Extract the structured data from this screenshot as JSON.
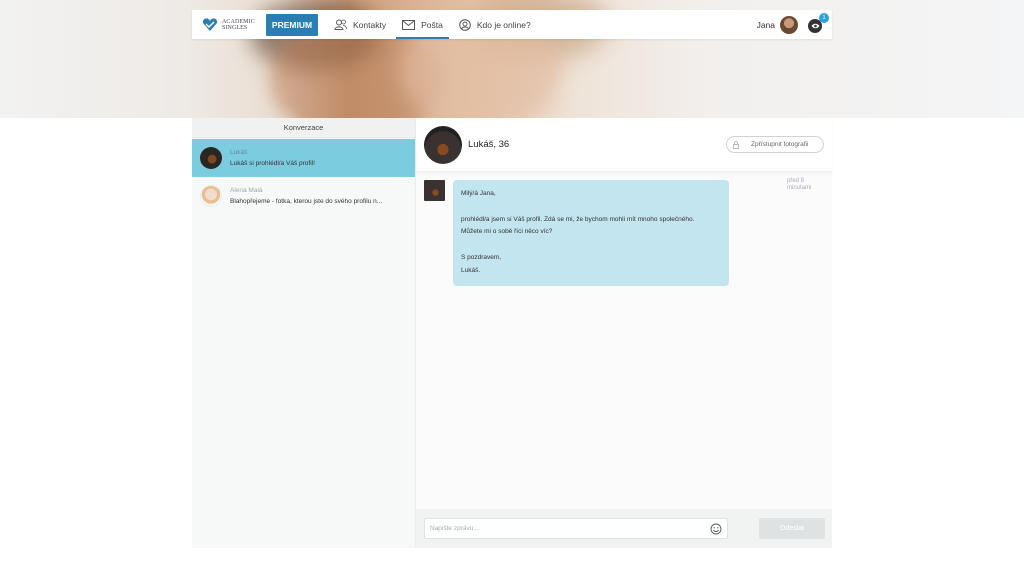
{
  "brand": {
    "name_line1": "ACADEMIC",
    "name_line2": "SINGLES",
    "accent": "#2a7fb0"
  },
  "nav": {
    "premium_label": "PREMIUM",
    "items": [
      {
        "label": "Kontakty",
        "icon": "contacts-icon"
      },
      {
        "label": "Pošta",
        "icon": "mail-icon",
        "active": true
      },
      {
        "label": "Kdo je online?",
        "icon": "online-icon"
      }
    ],
    "user_name": "Jana",
    "notification_count": "1"
  },
  "sidebar": {
    "header": "Konverzace",
    "conversations": [
      {
        "name": "Lukáš",
        "preview": "Lukáš si prohlédl/a Váš profil!",
        "active": true
      },
      {
        "name": "Alena Malá",
        "preview": "Blahopřejeme - fotka, kterou jste do svého profilu n..."
      }
    ]
  },
  "chat": {
    "title": "Lukáš, 36",
    "photo_button": "Zpřístupnit fotografii",
    "message": {
      "greeting": "Milý/á Jana,",
      "line1": "prohlédl/a jsem si Váš profil. Zdá se mi, že bychom mohli mít mnoho společného.",
      "line2": "Můžete mi o sobě říci něco víc?",
      "closing": "S pozdravem,",
      "signature": "Lukáš.",
      "time_line1": "před 8",
      "time_line2": "minutami"
    },
    "input_placeholder": "Napište zprávu...",
    "send_label": "Odeslat"
  }
}
